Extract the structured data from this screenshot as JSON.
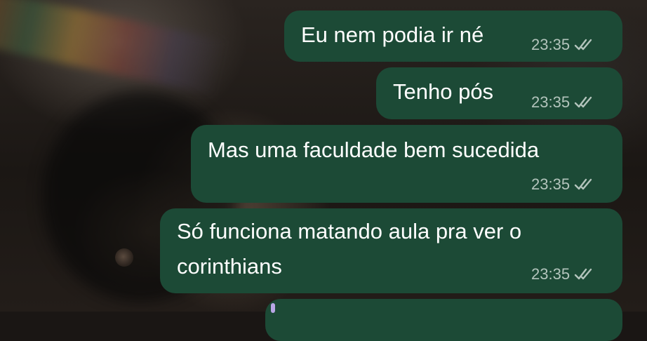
{
  "colors": {
    "outgoing_bubble": "#1c4a36",
    "message_text": "#ffffff",
    "timestamp_text": "#b3c4bc"
  },
  "messages": [
    {
      "text": "Eu nem podia ir né",
      "time": "23:35",
      "status_icon": "double-check-icon"
    },
    {
      "text": "Tenho pós",
      "time": "23:35",
      "status_icon": "double-check-icon"
    },
    {
      "text": "Mas uma faculdade bem sucedida",
      "time": "23:35",
      "status_icon": "double-check-icon"
    },
    {
      "text": "Só funciona matando aula pra ver o corinthians",
      "time": "23:35",
      "status_icon": "double-check-icon"
    }
  ]
}
